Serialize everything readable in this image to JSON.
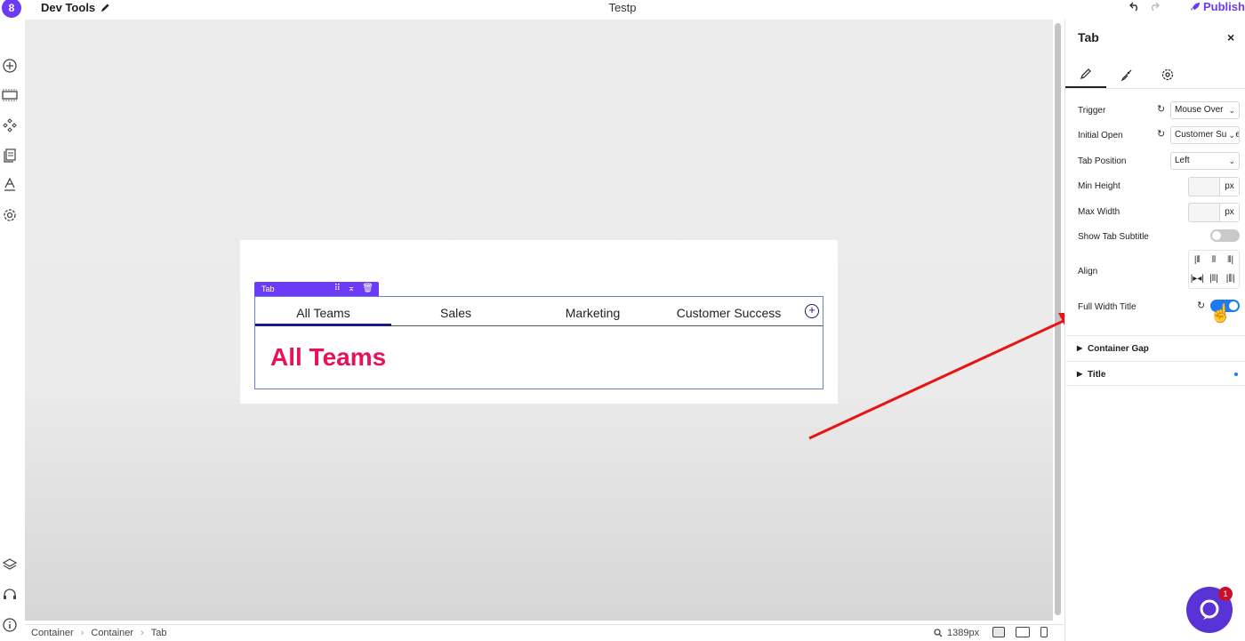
{
  "app": {
    "name": "Dev Tools",
    "document_title": "Testp",
    "publish_label": "Publish",
    "logo_glyph": "8"
  },
  "left_rail": {
    "icons": [
      "add-icon",
      "section-icon",
      "components-icon",
      "pages-icon",
      "typography-icon",
      "settings-icon",
      "layers-icon",
      "support-icon",
      "info-icon"
    ]
  },
  "canvas": {
    "tab_tag": "Tab",
    "tabs": [
      {
        "label": "All Teams",
        "active": true
      },
      {
        "label": "Sales",
        "active": false
      },
      {
        "label": "Marketing",
        "active": false
      },
      {
        "label": "Customer Success",
        "active": false
      }
    ],
    "add_glyph": "+",
    "content_title": "All Teams"
  },
  "statusbar": {
    "breadcrumbs": [
      "Container",
      "Container",
      "Tab"
    ],
    "zoom_label": "1389px"
  },
  "panel": {
    "title": "Tab",
    "close_glyph": "×",
    "trigger": {
      "label": "Trigger",
      "value": "Mouse Over"
    },
    "initial_open": {
      "label": "Initial Open",
      "value": "Customer Success"
    },
    "tab_position": {
      "label": "Tab Position",
      "value": "Left"
    },
    "min_height": {
      "label": "Min Height",
      "unit": "px"
    },
    "max_width": {
      "label": "Max Width",
      "unit": "px"
    },
    "show_subtitle": {
      "label": "Show Tab Subtitle",
      "on": false
    },
    "align": {
      "label": "Align"
    },
    "full_width_title": {
      "label": "Full Width Title",
      "on": true
    },
    "sections": [
      {
        "label": "Container Gap"
      },
      {
        "label": "Title"
      }
    ]
  },
  "chat": {
    "badge": "1"
  },
  "colors": {
    "brand": "#6c3bf5",
    "accent_pink": "#e8125c",
    "toggle_on": "#1e7af0",
    "arrow": "#e81414"
  }
}
